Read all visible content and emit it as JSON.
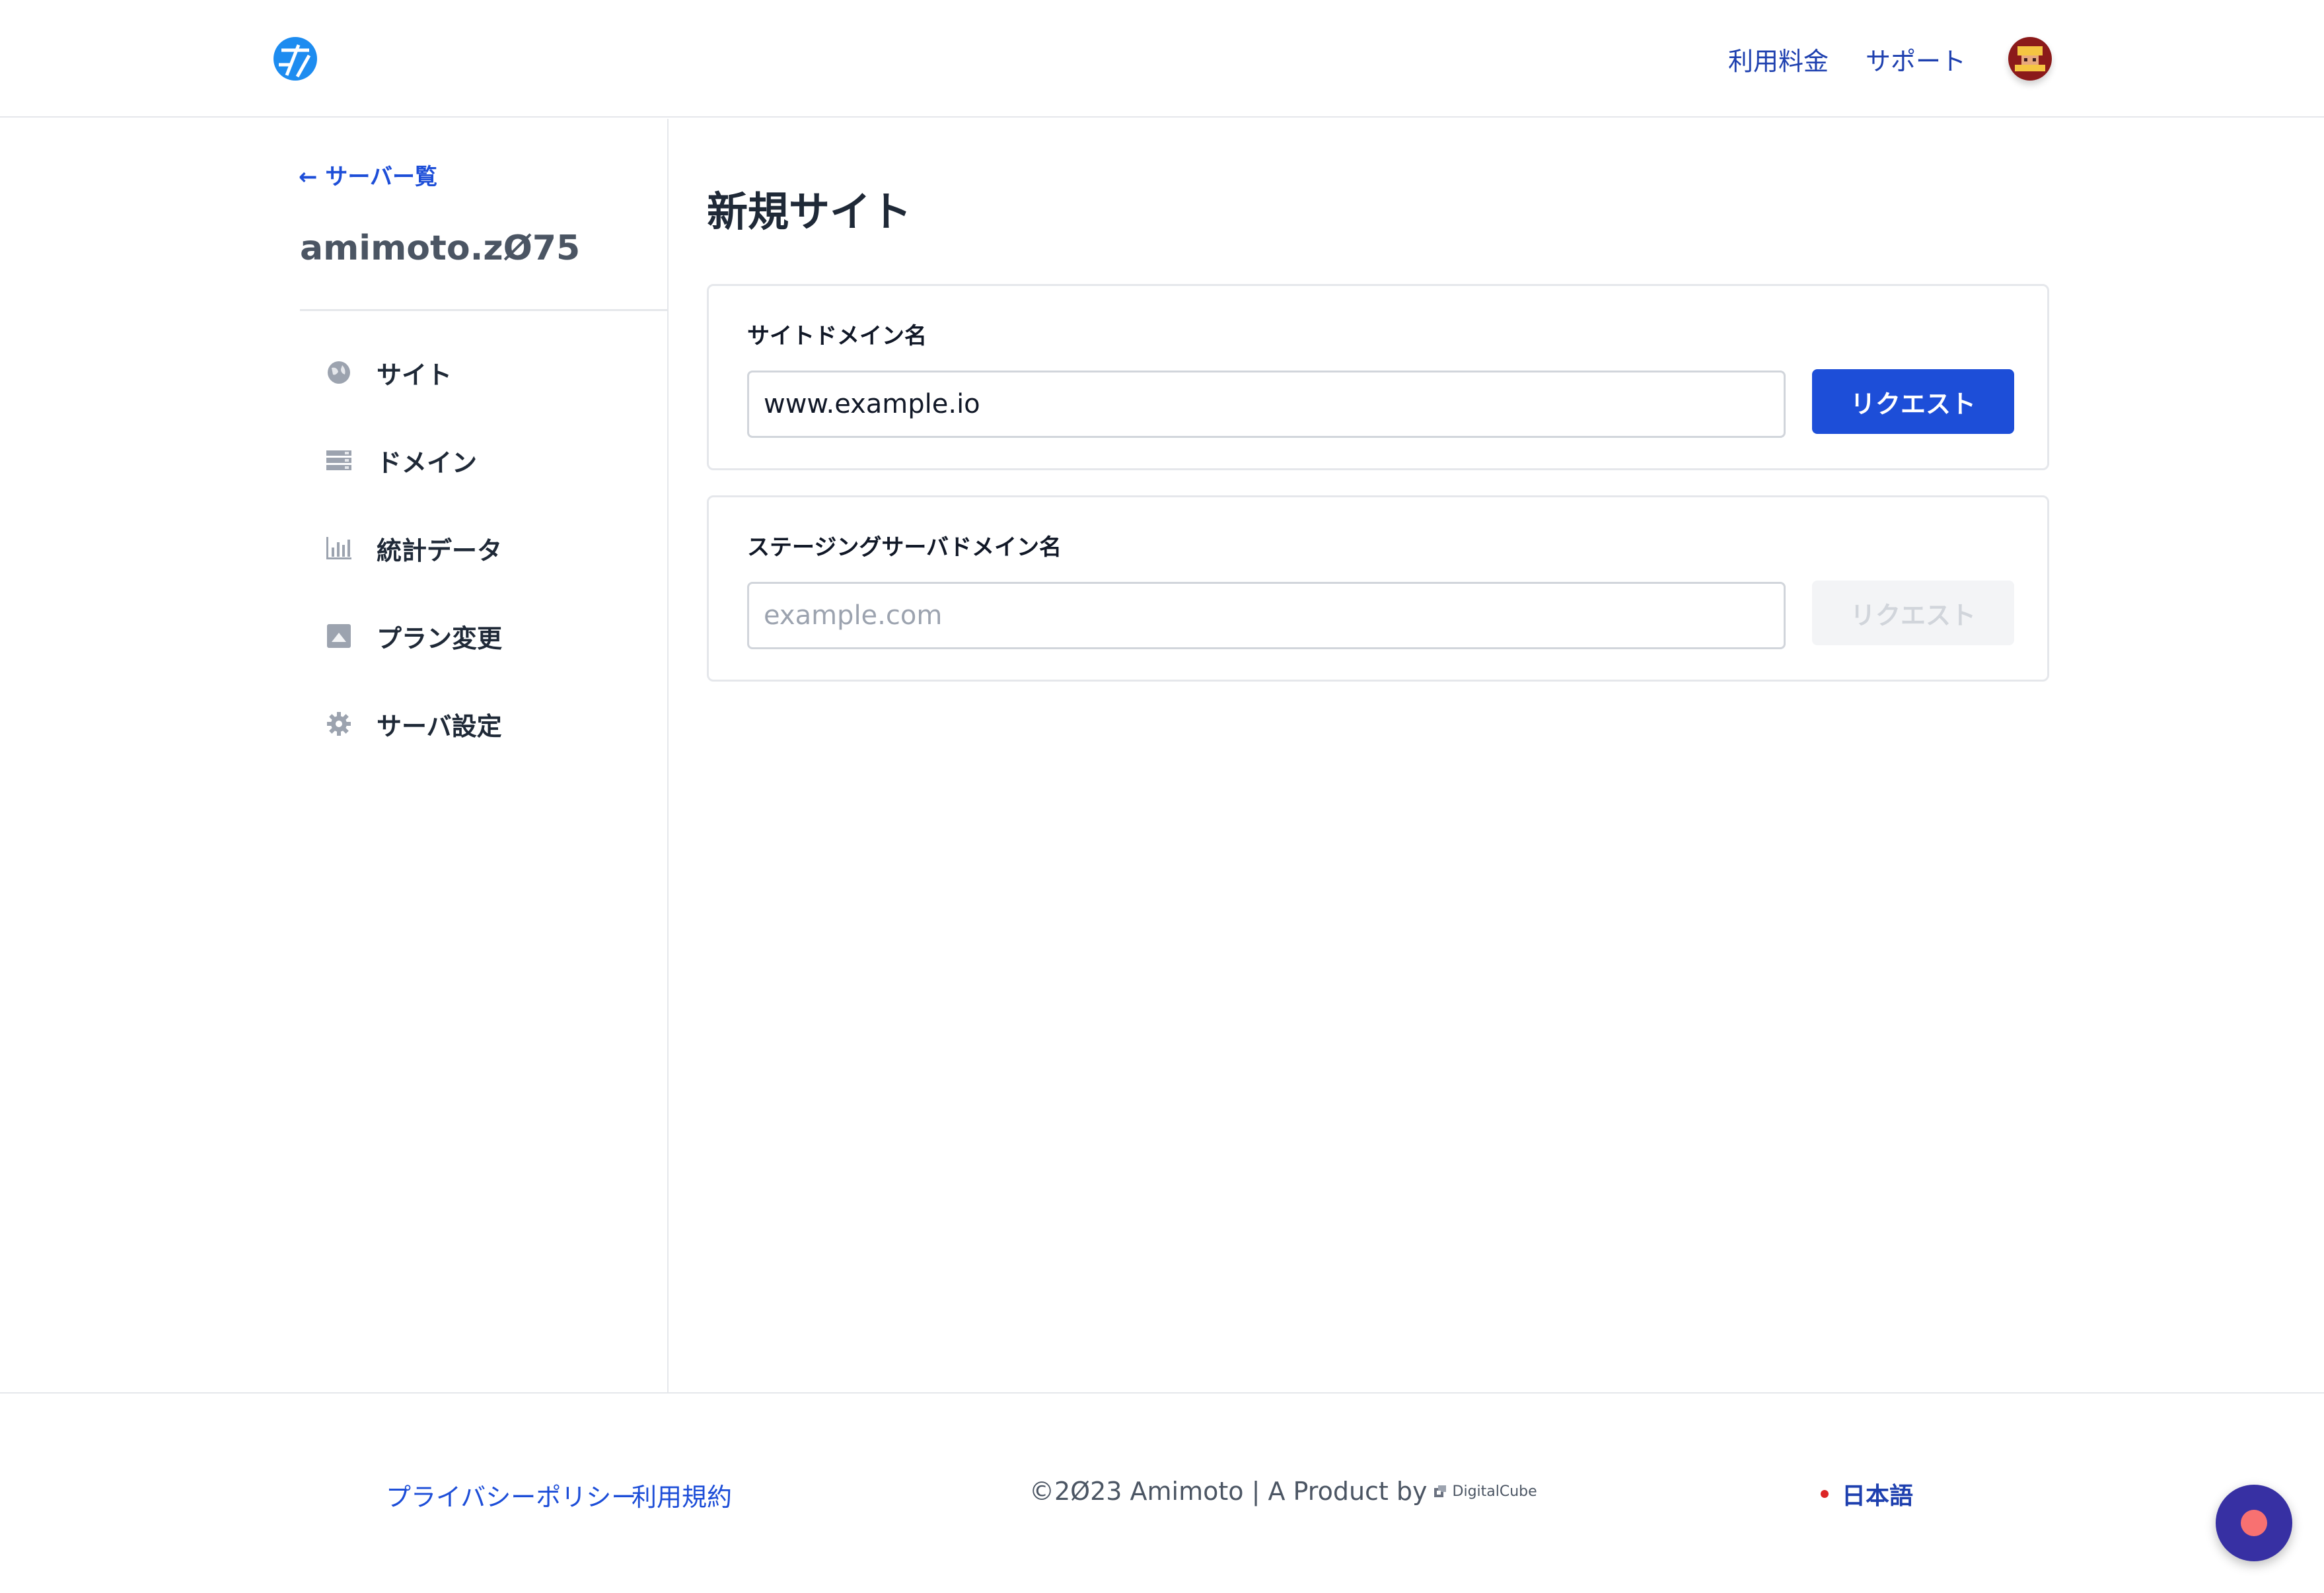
{
  "header": {
    "logo_icon": "amimoto-logo-icon",
    "nav": [
      {
        "label": "利用料金"
      },
      {
        "label": "サポート"
      }
    ],
    "avatar_icon": "user-avatar-icon"
  },
  "sidebar": {
    "back_link": "← サーバー覧",
    "server_name": "amimoto.zØ75",
    "items": [
      {
        "label": "サイト",
        "icon": "globe-icon"
      },
      {
        "label": "ドメイン",
        "icon": "server-stack-icon"
      },
      {
        "label": "統計データ",
        "icon": "bar-chart-icon"
      },
      {
        "label": "プラン変更",
        "icon": "upgrade-icon"
      },
      {
        "label": "サーバ設定",
        "icon": "gear-icon"
      }
    ]
  },
  "main": {
    "title": "新規サイト",
    "site_domain": {
      "label": "サイトドメイン名",
      "value": "www.example.io",
      "button": "リクエスト",
      "button_color": "#1d4ed8"
    },
    "staging_domain": {
      "label": "ステージングサーバドメイン名",
      "placeholder": "example.com",
      "button": "リクエスト"
    }
  },
  "footer": {
    "privacy": "プライバシーポリシー",
    "terms": "利用規約",
    "copyright": "©2Ø23 Amimoto | A Product by",
    "brand": "DigitalCube",
    "language": "日本語"
  },
  "chat_widget_icon": "chat-launcher-icon"
}
